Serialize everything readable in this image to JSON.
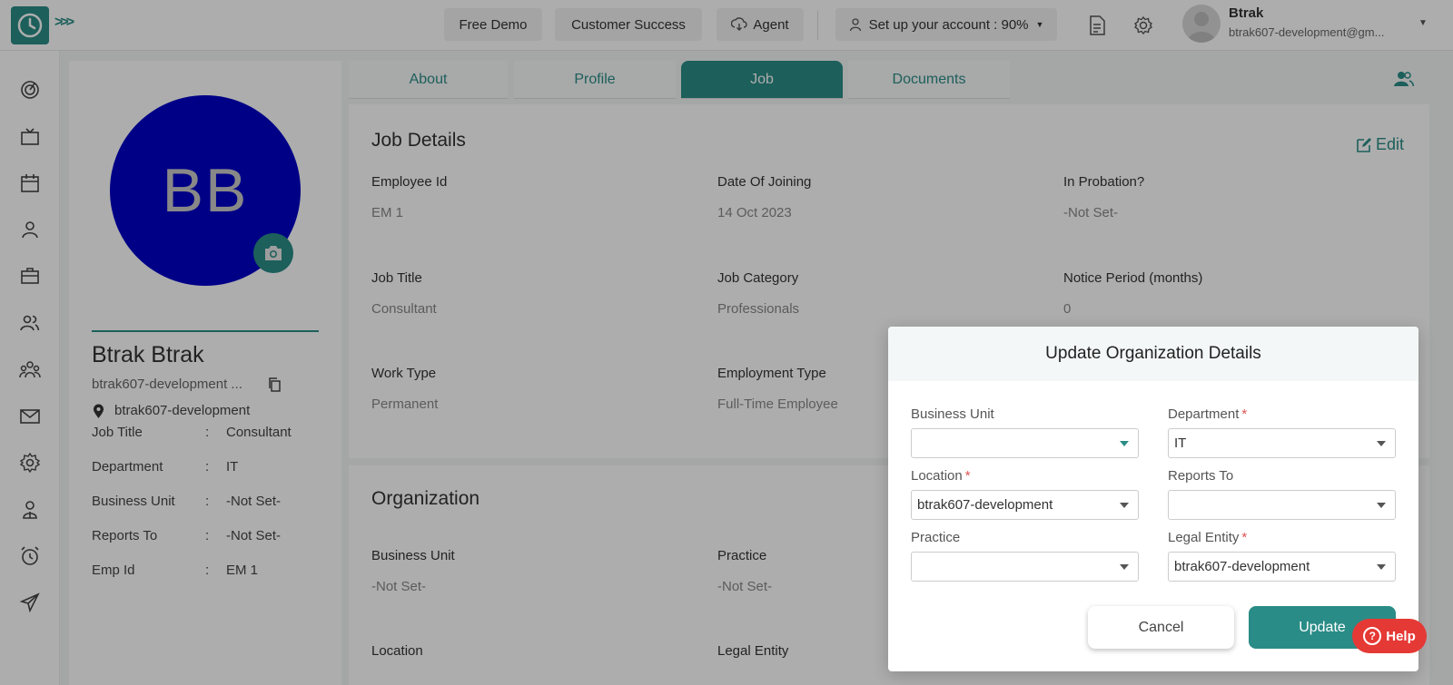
{
  "topbar": {
    "free_demo": "Free Demo",
    "customer_success": "Customer Success",
    "agent": "Agent",
    "setup": "Set up your account : 90%",
    "user_name": "Btrak",
    "user_email": "btrak607-development@gm..."
  },
  "profile": {
    "initials": "BB",
    "name": "Btrak Btrak",
    "email": "btrak607-development ...",
    "location": "btrak607-development",
    "separator": ":",
    "rows": [
      {
        "label": "Job Title",
        "value": "Consultant"
      },
      {
        "label": "Department",
        "value": "IT"
      },
      {
        "label": "Business Unit",
        "value": "-Not Set-"
      },
      {
        "label": "Reports To",
        "value": "-Not Set-"
      },
      {
        "label": "Emp Id",
        "value": "EM 1"
      }
    ]
  },
  "tabs": [
    "About",
    "Profile",
    "Job",
    "Documents"
  ],
  "job_details": {
    "title": "Job Details",
    "edit_label": "Edit",
    "fields": [
      {
        "label": "Employee Id",
        "value": "EM 1"
      },
      {
        "label": "Date Of Joining",
        "value": "14 Oct 2023"
      },
      {
        "label": "In Probation?",
        "value": "-Not Set-"
      },
      {
        "label": "Job Title",
        "value": "Consultant"
      },
      {
        "label": "Job Category",
        "value": "Professionals"
      },
      {
        "label": "Notice Period (months)",
        "value": "0"
      },
      {
        "label": "Work Type",
        "value": "Permanent"
      },
      {
        "label": "Employment Type",
        "value": "Full-Time Employee"
      }
    ]
  },
  "organization": {
    "title": "Organization",
    "fields": [
      {
        "label": "Business Unit",
        "value": "-Not Set-"
      },
      {
        "label": "Practice",
        "value": "-Not Set-"
      },
      {
        "label": "Location",
        "value": ""
      },
      {
        "label": "Legal Entity",
        "value": ""
      }
    ]
  },
  "modal": {
    "title": "Update Organization Details",
    "required_mark": "*",
    "fields": {
      "business_unit": {
        "label": "Business Unit",
        "value": ""
      },
      "department": {
        "label": "Department",
        "value": "IT"
      },
      "location": {
        "label": "Location",
        "value": "btrak607-development"
      },
      "reports_to": {
        "label": "Reports To",
        "value": ""
      },
      "practice": {
        "label": "Practice",
        "value": ""
      },
      "legal_entity": {
        "label": "Legal Entity",
        "value": "btrak607-development"
      }
    },
    "cancel_label": "Cancel",
    "update_label": "Update"
  },
  "help": {
    "label": "Help",
    "glyph": "?"
  },
  "colors": {
    "accent": "#2a8c86",
    "avatar_bg": "#0000c8",
    "help": "#e53935"
  }
}
